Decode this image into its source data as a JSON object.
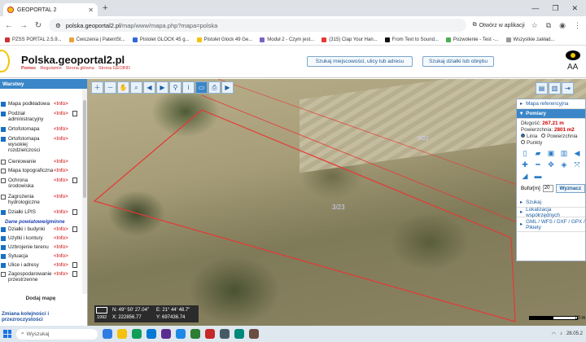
{
  "browser": {
    "tab_title": "GEOPORTAL 2",
    "url_prefix": "polska.geoportal2.pl",
    "url_rest": "/map/www/mapa.php?mapa=polska",
    "open_in_app": "Otwórz w aplikacji",
    "bookmarks": [
      {
        "label": "PZSS PORTAL 2.5.9...",
        "color": "#c33"
      },
      {
        "label": "Ćwiczenia | PatentSt...",
        "color": "#e8a33d"
      },
      {
        "label": "Pistolet GLOCK 45 g...",
        "color": "#3367d6"
      },
      {
        "label": "Pistolet Glock 49 Ge...",
        "color": "#f4c20d"
      },
      {
        "label": "Moduł 2 - Czym jest...",
        "color": "#7b61c4"
      },
      {
        "label": "(315) Clap Your Han...",
        "color": "#e53935"
      },
      {
        "label": "From Text to Sound...",
        "color": "#111"
      },
      {
        "label": "Pozwolenie - Test -...",
        "color": "#4caf50"
      },
      {
        "label": "Wszystkie zakład...",
        "color": "#999"
      }
    ]
  },
  "site": {
    "title": "Polska.geoportal2.pl",
    "links": [
      "Pomoc",
      "Regulamin",
      "Strona główna",
      "Strona GEOBID"
    ],
    "search_address_btn": "Szukaj miejscowości, ulicy lub adresu",
    "search_parcel_btn": "Szukaj działki lub obrębu",
    "font_size_label": "AA"
  },
  "layers": {
    "title": "Warstwy",
    "items": [
      {
        "name": "Mapa podkładowa",
        "info": "<Info>",
        "checked": true,
        "doc": false
      },
      {
        "name": "Podział administracyjny",
        "info": "<Info>",
        "checked": true,
        "doc": true
      },
      {
        "name": "Ortofotomapa",
        "info": "<Info>",
        "checked": true,
        "doc": false
      },
      {
        "name": "Ortofotomapa wysokiej rozdzielczości",
        "info": "<Info>",
        "checked": true,
        "doc": false
      },
      {
        "name": "Cieniowanie",
        "info": "<Info>",
        "checked": false,
        "doc": false
      },
      {
        "name": "Mapa topograficzna",
        "info": "<Info>",
        "checked": false,
        "doc": false
      },
      {
        "name": "Ochrona środowiska",
        "info": "<Info>",
        "checked": false,
        "doc": true
      },
      {
        "name": "Zagrożenia hydrologiczne",
        "info": "<Info>",
        "checked": false,
        "doc": false
      },
      {
        "name": "Działki LPIS",
        "info": "<Info>",
        "checked": true,
        "doc": true
      },
      {
        "name": "Działki i budynki",
        "info": "<Info>",
        "checked": true,
        "doc": true
      },
      {
        "name": "Użytki i kontury",
        "info": "<Info>",
        "checked": true,
        "doc": false
      },
      {
        "name": "Uzbrojenie terenu",
        "info": "<Info>",
        "checked": true,
        "doc": false
      },
      {
        "name": "Sytuacja",
        "info": "<Info>",
        "checked": true,
        "doc": false
      },
      {
        "name": "Ulice i adresy",
        "info": "<Info>",
        "checked": true,
        "doc": true
      },
      {
        "name": "Zagospodarowanie przestrzenne",
        "info": "<Info>",
        "checked": false,
        "doc": true
      }
    ],
    "section_label": "Dane powiatowe/gminne",
    "add_map": "Dodaj mapę",
    "order_link": "Zmiana kolejności i przezroczystości"
  },
  "measure": {
    "ref_map": "Mapa referencyjna",
    "section": "Pomiary",
    "length_label": "Długość:",
    "length_value": "267.21 m",
    "area_label": "Powierzchnia:",
    "area_value": "2801 m2",
    "opt_line": "Linia",
    "opt_area": "Powierzchnia",
    "opt_points": "Punkty",
    "buffer_label": "Bufor[m]",
    "buffer_value": "20",
    "buffer_btn": "Wyznacz",
    "search": "Szukaj",
    "localization": "Lokalizacja współrzędnych",
    "gml": "GML / WFS / DXF / GPX / Pikiety"
  },
  "map": {
    "parcel_label": "3/23",
    "parcel_label_2": "3/22",
    "coords_epsg": "1992",
    "coord_n": "N: 49° 50' 27.04\"",
    "coord_e": "E: 21° 44' 48.7\"",
    "coord_x": "X: 222856.77",
    "coord_y": "Y: 697436.74",
    "scale": "10 m"
  },
  "taskbar": {
    "search": "Wyszukaj",
    "time": "28.05.2"
  }
}
